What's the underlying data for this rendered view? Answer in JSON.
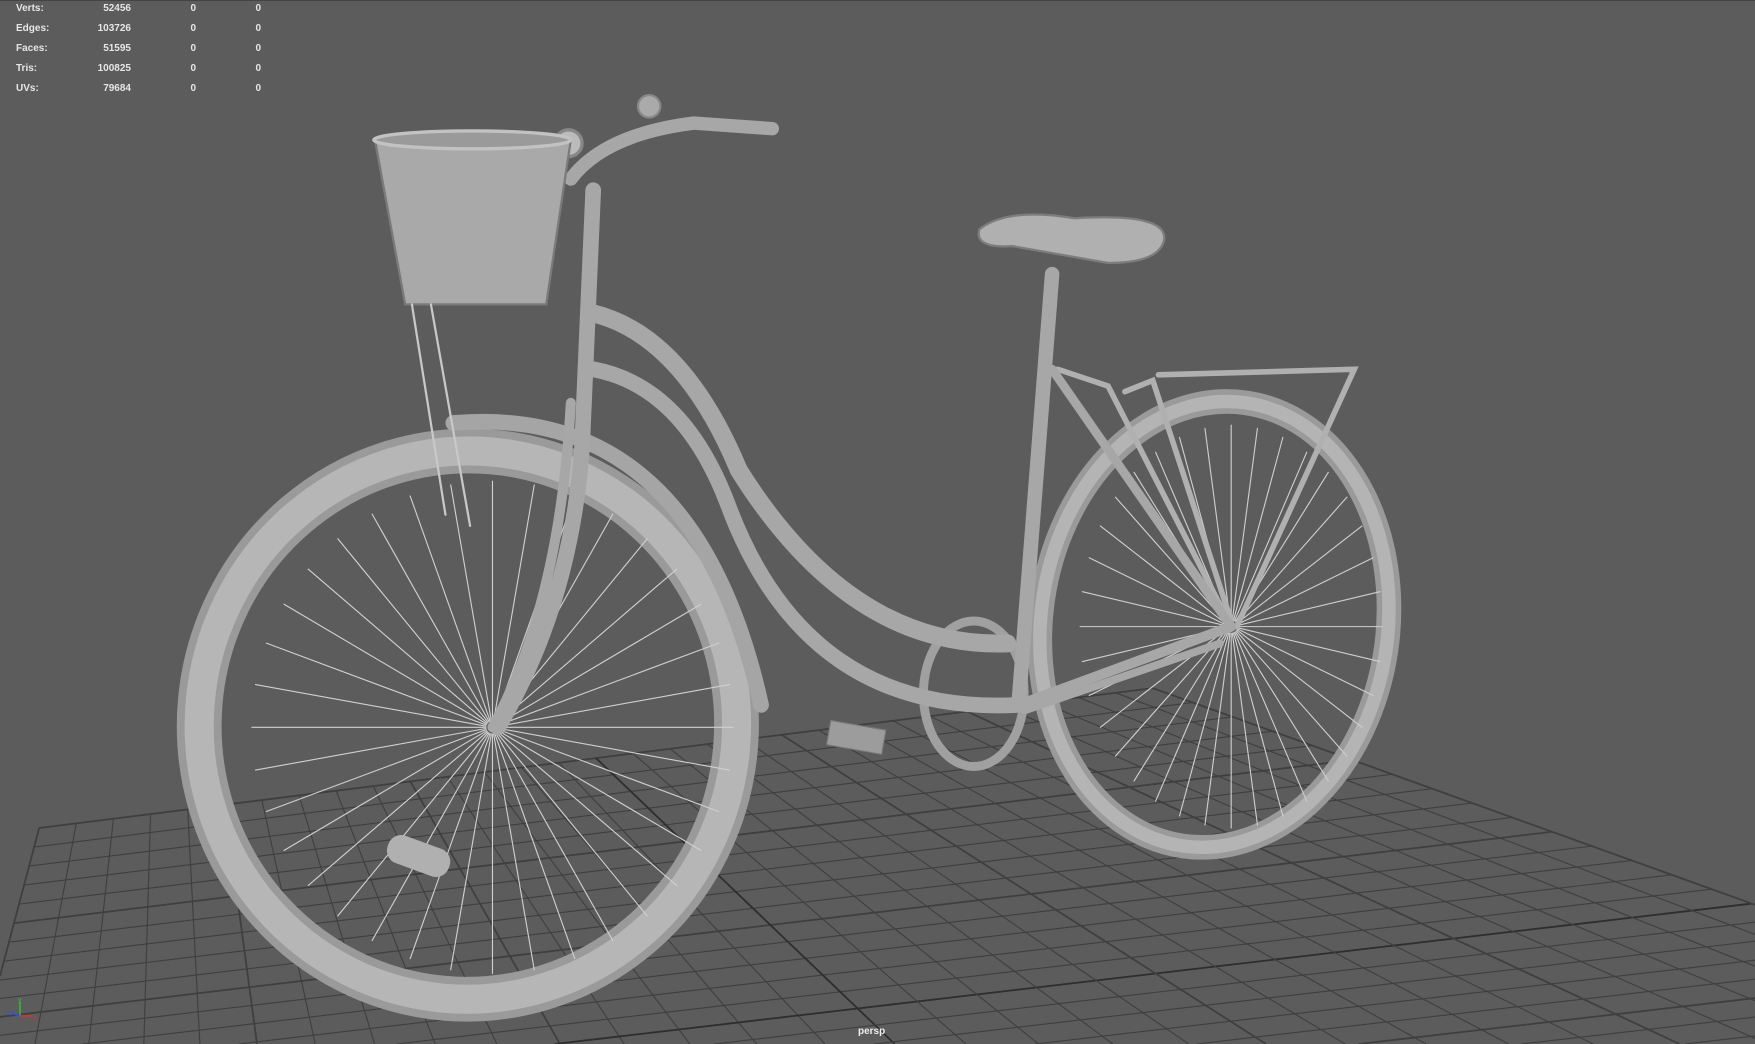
{
  "hud": {
    "rows": [
      {
        "label": "Verts:",
        "values": [
          "52456",
          "0",
          "0"
        ]
      },
      {
        "label": "Edges:",
        "values": [
          "103726",
          "0",
          "0"
        ]
      },
      {
        "label": "Faces:",
        "values": [
          "51595",
          "0",
          "0"
        ]
      },
      {
        "label": "Tris:",
        "values": [
          "100825",
          "0",
          "0"
        ]
      },
      {
        "label": "UVs:",
        "values": [
          "79684",
          "0",
          "0"
        ]
      }
    ]
  },
  "camera_label": "persp",
  "axis": {
    "x": "x",
    "y": "y",
    "z": "z"
  },
  "colors": {
    "background": "#5c5c5c",
    "model": "#a9a9a9",
    "grid": "#3e3e3e",
    "x_axis": "#e03030",
    "y_axis": "#30c030",
    "z_axis": "#3050ff"
  }
}
